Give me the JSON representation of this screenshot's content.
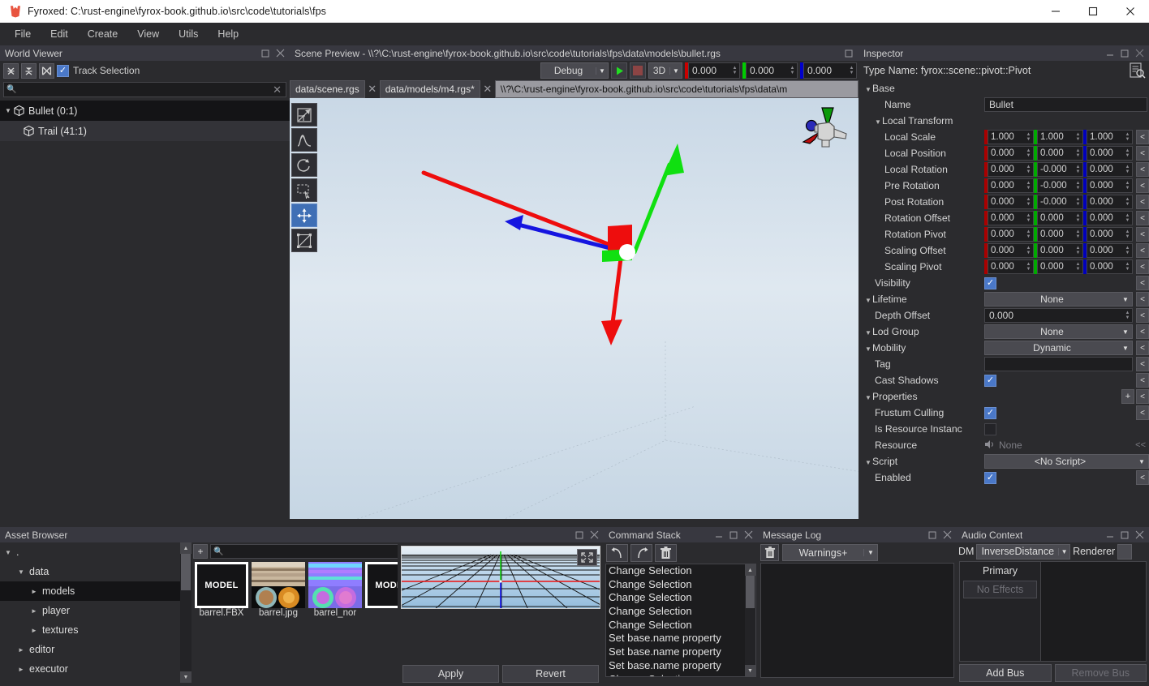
{
  "window": {
    "title": "Fyroxed: C:\\rust-engine\\fyrox-book.github.io\\src\\code\\tutorials\\fps",
    "logo_icon": "fyrox-logo-icon",
    "controls": [
      {
        "name": "minimize-button",
        "glyph": "—"
      },
      {
        "name": "maximize-button",
        "glyph": "☐"
      },
      {
        "name": "close-button",
        "glyph": "✕"
      }
    ]
  },
  "menubar": {
    "items": [
      {
        "label": "File",
        "name": "menu-file"
      },
      {
        "label": "Edit",
        "name": "menu-edit"
      },
      {
        "label": "Create",
        "name": "menu-create"
      },
      {
        "label": "View",
        "name": "menu-view"
      },
      {
        "label": "Utils",
        "name": "menu-utils"
      },
      {
        "label": "Help",
        "name": "menu-help"
      }
    ]
  },
  "world_viewer": {
    "title": "World Viewer",
    "toolbar": {
      "collapse_all_icon": "collapse-all-icon",
      "expand_all_icon": "expand-all-icon",
      "locate_selection_icon": "locate-selection-icon",
      "track_selection_label": "Track Selection",
      "track_selection_checked": true
    },
    "search": {
      "value": "",
      "placeholder": ""
    },
    "tree": [
      {
        "label": "Bullet (0:1)",
        "depth": 0,
        "selected": true,
        "expanded": true
      },
      {
        "label": "Trail (41:1)",
        "depth": 1,
        "selected": false,
        "expanded": false
      }
    ]
  },
  "scene_preview": {
    "title": "Scene Preview - \\\\?\\C:\\rust-engine\\fyrox-book.github.io\\src\\code\\tutorials\\fps\\data\\models\\bullet.rgs",
    "toolbar": {
      "build_profile": "Debug",
      "play_icon": "play-icon",
      "stop_icon": "stop-icon",
      "mode": "3D",
      "snap_x": "0.000",
      "snap_y": "0.000",
      "snap_z": "0.000"
    },
    "tabs": [
      {
        "label": "data/scene.rgs",
        "active": false,
        "closable": true
      },
      {
        "label": "data/models/m4.rgs*",
        "active": false,
        "closable": true
      },
      {
        "label": "\\\\?\\C:\\rust-engine\\fyrox-book.github.io\\src\\code\\tutorials\\fps\\data\\m",
        "active": true,
        "closable": false
      }
    ],
    "viewport_tools": [
      {
        "name": "select-tool",
        "icon": "select-arrow-icon",
        "active": false
      },
      {
        "name": "terrain-tool",
        "icon": "terrain-icon",
        "active": false
      },
      {
        "name": "rotate-tool",
        "icon": "rotate-arrow-icon",
        "active": false
      },
      {
        "name": "marquee-select-tool",
        "icon": "marquee-select-icon",
        "active": false
      },
      {
        "name": "move-tool",
        "icon": "move-cross-icon",
        "active": true
      },
      {
        "name": "scale-tool",
        "icon": "scale-icon",
        "active": false
      }
    ],
    "gizmo": {
      "x_color": "#ee1111",
      "y_color": "#11dd11",
      "z_color": "#1111dd"
    },
    "axis_widget_name": "view-orientation-gizmo"
  },
  "inspector": {
    "title": "Inspector",
    "type_name": "Type Name: fyrox::scene::pivot::Pivot",
    "doc_icon": "document-search-icon",
    "groups": [
      {
        "name": "Base",
        "expanded": true
      }
    ],
    "fields": {
      "name_label": "Name",
      "name_value": "Bullet",
      "local_transform_label": "Local Transform",
      "visibility_label": "Visibility",
      "visibility_checked": true,
      "lifetime_label": "Lifetime",
      "lifetime_value": "None",
      "depth_offset_label": "Depth Offset",
      "depth_offset_value": "0.000",
      "lod_group_label": "Lod Group",
      "lod_group_value": "None",
      "mobility_label": "Mobility",
      "mobility_value": "Dynamic",
      "tag_label": "Tag",
      "tag_value": "",
      "cast_shadows_label": "Cast Shadows",
      "cast_shadows_checked": true,
      "properties_label": "Properties",
      "properties_add": "+",
      "frustum_culling_label": "Frustum Culling",
      "frustum_culling_checked": true,
      "is_resource_instance_label": "Is Resource Instanc",
      "is_resource_instance_checked": false,
      "resource_label": "Resource",
      "resource_value": "None",
      "resource_icon": "speaker-icon",
      "resource_nav": "<<",
      "script_label": "Script",
      "script_value": "<No Script>",
      "enabled_label": "Enabled",
      "enabled_checked": true,
      "revert_glyph": "<"
    },
    "transform_rows": [
      {
        "label": "Local Scale",
        "x": "1.000",
        "y": "1.000",
        "z": "1.000"
      },
      {
        "label": "Local Position",
        "x": "0.000",
        "y": "0.000",
        "z": "0.000"
      },
      {
        "label": "Local Rotation",
        "x": "0.000",
        "y": "-0.000",
        "z": "0.000"
      },
      {
        "label": "Pre Rotation",
        "x": "0.000",
        "y": "-0.000",
        "z": "0.000"
      },
      {
        "label": "Post Rotation",
        "x": "0.000",
        "y": "-0.000",
        "z": "0.000"
      },
      {
        "label": "Rotation Offset",
        "x": "0.000",
        "y": "0.000",
        "z": "0.000"
      },
      {
        "label": "Rotation Pivot",
        "x": "0.000",
        "y": "0.000",
        "z": "0.000"
      },
      {
        "label": "Scaling Offset",
        "x": "0.000",
        "y": "0.000",
        "z": "0.000"
      },
      {
        "label": "Scaling Pivot",
        "x": "0.000",
        "y": "0.000",
        "z": "0.000"
      }
    ]
  },
  "asset_browser": {
    "title": "Asset Browser",
    "tree": [
      {
        "label": ".",
        "depth": 0,
        "expanded": true,
        "selected": false
      },
      {
        "label": "data",
        "depth": 1,
        "expanded": true,
        "selected": false
      },
      {
        "label": "models",
        "depth": 2,
        "expanded": false,
        "selected": true
      },
      {
        "label": "player",
        "depth": 2,
        "expanded": false,
        "selected": false
      },
      {
        "label": "textures",
        "depth": 2,
        "expanded": false,
        "selected": false
      },
      {
        "label": "editor",
        "depth": 1,
        "expanded": false,
        "selected": false
      },
      {
        "label": "executor",
        "depth": 1,
        "expanded": false,
        "selected": false
      }
    ],
    "add_button": "+",
    "search": {
      "value": "",
      "placeholder": ""
    },
    "assets": [
      {
        "label": "barrel.FBX",
        "kind": "model"
      },
      {
        "label": "barrel.jpg",
        "kind": "texture-barrel"
      },
      {
        "label": "barrel_nor",
        "kind": "texture-normal"
      },
      {
        "label": "",
        "kind": "model"
      },
      {
        "label": "",
        "kind": "model"
      },
      {
        "label": "",
        "kind": "texture-noise"
      }
    ]
  },
  "asset_preview": {
    "expand_icon": "expand-icon",
    "apply_label": "Apply",
    "revert_label": "Revert"
  },
  "command_stack": {
    "title": "Command Stack",
    "toolbar": [
      {
        "name": "undo-button",
        "icon": "undo-arrow-icon"
      },
      {
        "name": "redo-button",
        "icon": "redo-arrow-icon"
      },
      {
        "name": "clear-button",
        "icon": "trash-icon"
      }
    ],
    "items": [
      "Change Selection",
      "Change Selection",
      "Change Selection",
      "Change Selection",
      "Change Selection",
      "Set base.name property",
      "Set base.name property",
      "Set base.name property",
      "Change Selection"
    ]
  },
  "message_log": {
    "title": "Message Log",
    "clear_icon": "trash-icon",
    "filter": "Warnings+",
    "entries": []
  },
  "audio_context": {
    "title": "Audio Context",
    "dm_label": "DM",
    "distance_model": "InverseDistance",
    "renderer_label": "Renderer",
    "renderer_value": "",
    "bus_name": "Primary",
    "no_effects": "No Effects",
    "add_bus_label": "Add Bus",
    "remove_bus_label": "Remove Bus"
  },
  "colors": {
    "accent_blue": "#4a78c8",
    "axis_x": "#cc0000",
    "axis_y": "#00cc00",
    "axis_z": "#0000cc",
    "panel_bg": "#2b2b2e",
    "panel_head": "#383840",
    "titlebar_bg": "#ffffff"
  }
}
